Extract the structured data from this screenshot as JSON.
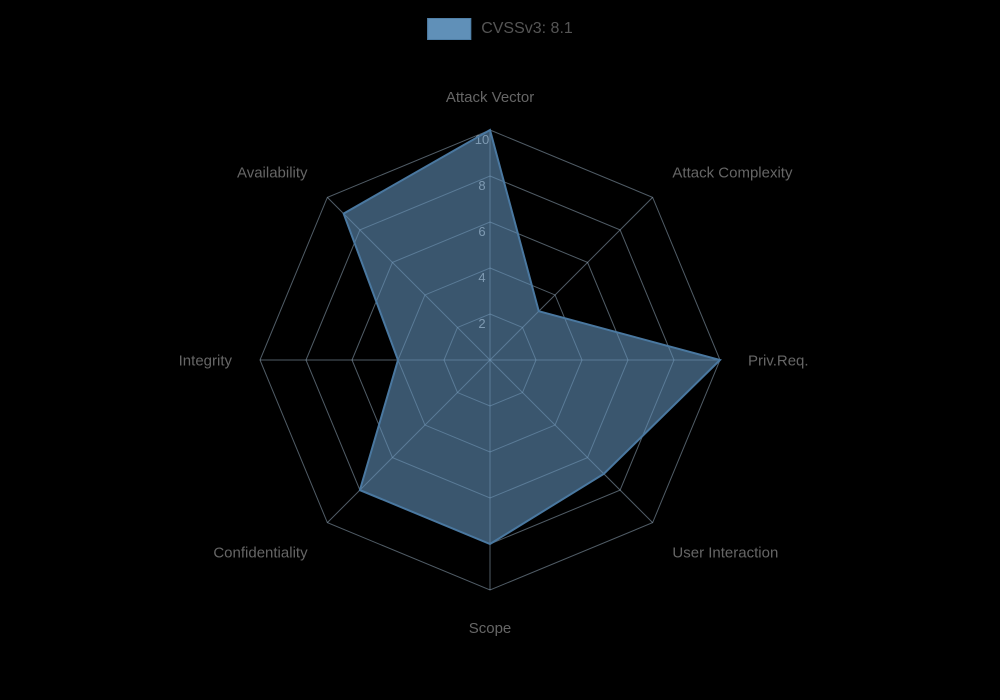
{
  "chart": {
    "title": "CVSSv3: 8.1",
    "axes": [
      {
        "label": "Attack Vector",
        "value": 10
      },
      {
        "label": "Attack Complexity",
        "value": 3
      },
      {
        "label": "Priv.Req.",
        "value": 10
      },
      {
        "label": "User Interaction",
        "value": 7
      },
      {
        "label": "Scope",
        "value": 8
      },
      {
        "label": "Confidentiality",
        "value": 8
      },
      {
        "label": "Integrity",
        "value": 4
      },
      {
        "label": "Availability",
        "value": 9
      }
    ],
    "maxValue": 10,
    "rings": [
      2,
      4,
      6,
      8,
      10
    ],
    "ringLabels": [
      "2",
      "4",
      "6",
      "8",
      "10"
    ],
    "colors": {
      "fill": "#6090b8",
      "fillOpacity": "0.6",
      "stroke": "#4a78a0",
      "gridLine": "#a0b8cc",
      "gridLineOpacity": "0.5",
      "labelColor": "#666"
    }
  },
  "legend": {
    "label": "CVSSv3: 8.1"
  }
}
